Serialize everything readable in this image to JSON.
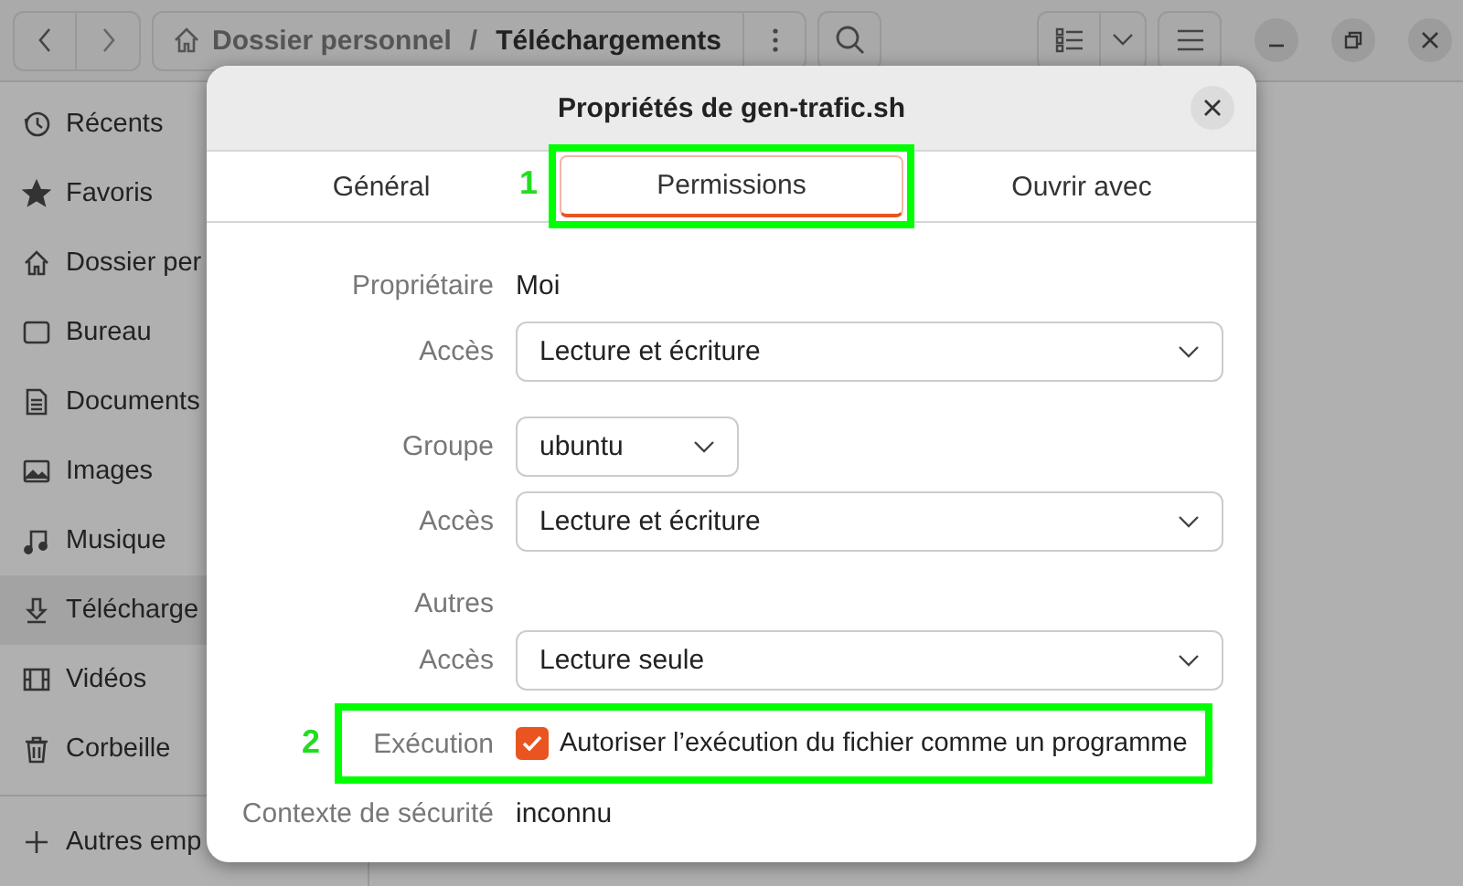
{
  "header": {
    "path": [
      {
        "label": "Dossier personnel",
        "current": false
      },
      {
        "label": "Téléchargements",
        "current": true
      }
    ],
    "separator": "/"
  },
  "sidebar": {
    "items": [
      {
        "label": "Récents",
        "selected": false
      },
      {
        "label": "Favoris",
        "selected": false
      },
      {
        "label": "Dossier per",
        "selected": false
      },
      {
        "label": "Bureau",
        "selected": false
      },
      {
        "label": "Documents",
        "selected": false
      },
      {
        "label": "Images",
        "selected": false
      },
      {
        "label": "Musique",
        "selected": false
      },
      {
        "label": "Télécharge",
        "selected": true
      },
      {
        "label": "Vidéos",
        "selected": false
      },
      {
        "label": "Corbeille",
        "selected": false
      }
    ],
    "other": {
      "label": "Autres emp"
    }
  },
  "dialog": {
    "title": "Propriétés de gen-trafic.sh",
    "tabs": [
      {
        "label": "Général",
        "selected": false
      },
      {
        "label": "Permissions",
        "selected": true,
        "callout": "1"
      },
      {
        "label": "Ouvrir avec",
        "selected": false
      }
    ],
    "rows": [
      {
        "kind": "text",
        "label": "Propriétaire",
        "value": "Moi"
      },
      {
        "kind": "combo",
        "label": "Accès",
        "value": "Lecture et écriture"
      },
      {
        "kind": "combo-small",
        "label": "Groupe",
        "value": "ubuntu"
      },
      {
        "kind": "combo",
        "label": "Accès",
        "value": "Lecture et écriture"
      },
      {
        "kind": "heading",
        "label": "Autres"
      },
      {
        "kind": "combo",
        "label": "Accès",
        "value": "Lecture seule"
      },
      {
        "kind": "checkbox",
        "label": "Exécution",
        "text": "Autoriser l’exécution du fichier comme un programme",
        "checked": true,
        "callout": "2"
      },
      {
        "kind": "text",
        "label": "Contexte de sécurité",
        "value": "inconnu"
      }
    ]
  }
}
